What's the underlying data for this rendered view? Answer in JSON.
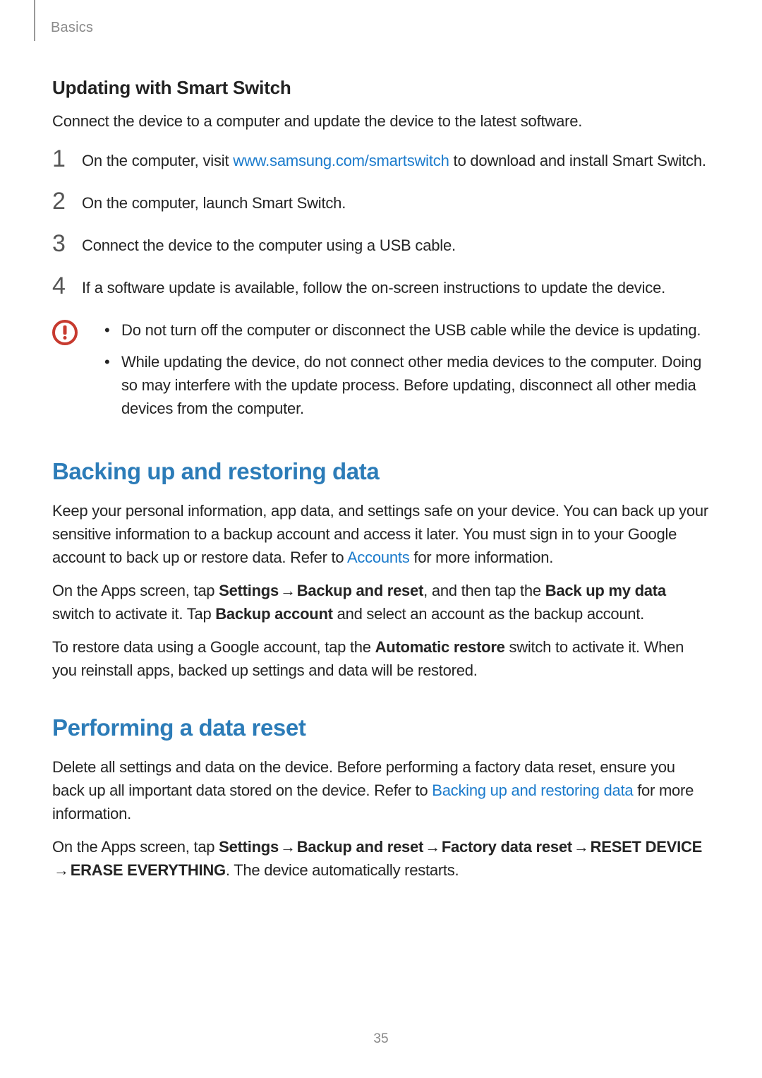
{
  "header": {
    "section_label": "Basics"
  },
  "update": {
    "heading": "Updating with Smart Switch",
    "intro": "Connect the device to a computer and update the device to the latest software.",
    "steps": {
      "s1_pre": "On the computer, visit ",
      "s1_link": "www.samsung.com/smartswitch",
      "s1_post": " to download and install Smart Switch.",
      "s2": "On the computer, launch Smart Switch.",
      "s3": "Connect the device to the computer using a USB cable.",
      "s4": "If a software update is available, follow the on-screen instructions to update the device."
    },
    "caution": {
      "c1": "Do not turn off the computer or disconnect the USB cable while the device is updating.",
      "c2": "While updating the device, do not connect other media devices to the computer. Doing so may interfere with the update process. Before updating, disconnect all other media devices from the computer."
    }
  },
  "backup": {
    "heading": "Backing up and restoring data",
    "p1_pre": "Keep your personal information, app data, and settings safe on your device. You can back up your sensitive information to a backup account and access it later. You must sign in to your Google account to back up or restore data. Refer to ",
    "p1_link": "Accounts",
    "p1_post": " for more information.",
    "p2_a": "On the Apps screen, tap ",
    "p2_b1": "Settings",
    "p2_arrow": " → ",
    "p2_b2": "Backup and reset",
    "p2_c": ", and then tap the ",
    "p2_b3": "Back up my data",
    "p2_d": " switch to activate it. Tap ",
    "p2_b4": "Backup account",
    "p2_e": " and select an account as the backup account.",
    "p3_a": "To restore data using a Google account, tap the ",
    "p3_b1": "Automatic restore",
    "p3_c": " switch to activate it. When you reinstall apps, backed up settings and data will be restored."
  },
  "reset": {
    "heading": "Performing a data reset",
    "p1_pre": "Delete all settings and data on the device. Before performing a factory data reset, ensure you back up all important data stored on the device. Refer to ",
    "p1_link": "Backing up and restoring data",
    "p1_post": " for more information.",
    "p2_a": "On the Apps screen, tap ",
    "p2_b1": "Settings",
    "p2_arrow": " → ",
    "p2_b2": "Backup and reset",
    "p2_b3": "Factory data reset",
    "p2_b4": "RESET DEVICE",
    "p2_b5": "ERASE EVERYTHING",
    "p2_end": ". The device automatically restarts."
  },
  "page_number": "35",
  "nums": {
    "n1": "1",
    "n2": "2",
    "n3": "3",
    "n4": "4"
  }
}
